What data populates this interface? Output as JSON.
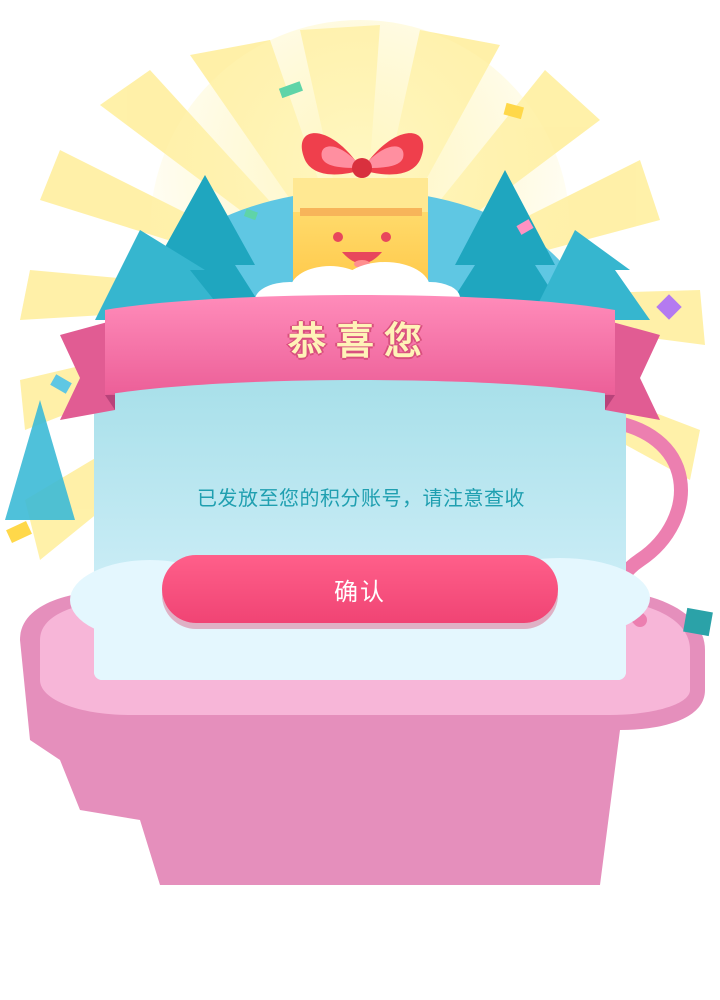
{
  "dialog": {
    "title": "恭喜您",
    "message": "已发放至您的积分账号，请注意查收",
    "confirm_label": "确认"
  },
  "colors": {
    "ribbon": "#f46fa6",
    "card_top": "#a8e0ea",
    "card_bottom": "#d9f3fb",
    "button": "#f04474",
    "message_text": "#1f9fb0",
    "title_text": "#fff3b8",
    "rays": "#fff1a8",
    "pink_platform": "#e48fbb"
  },
  "icons": {
    "mascot": "gift-box-mascot-icon",
    "bow": "red-bow-icon"
  }
}
